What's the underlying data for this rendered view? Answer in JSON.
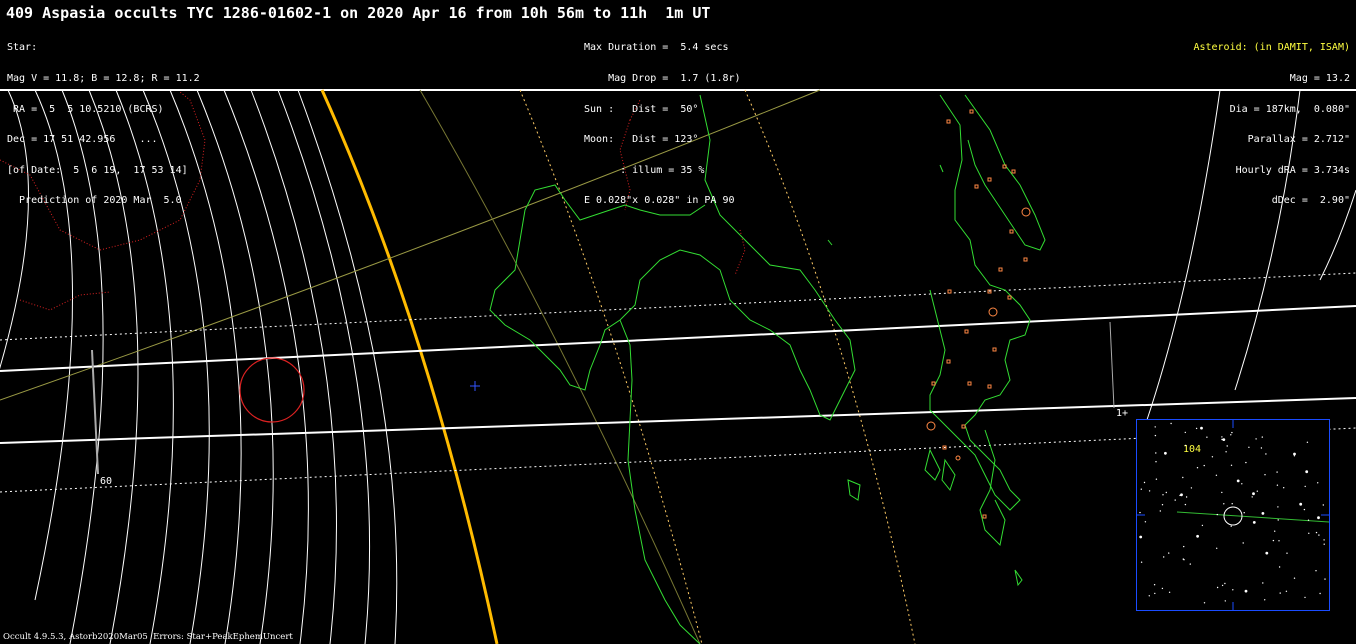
{
  "header": {
    "title": "409 Aspasia occults TYC 1286-01602-1 on 2020 Apr 16 from 10h 56m to 11h  1m UT",
    "star": {
      "heading": "Star:",
      "mag": "Mag V = 11.8; B = 12.8; R = 11.2",
      "ra": " RA =  5  5 10.5210 (BCRS)",
      "dec": "Dec = 17 51 42.956    ...",
      "of_date": "[of Date:  5  6 19,  17 53 14]",
      "prediction": "  Prediction of 2020 Mar  5.0"
    },
    "event": {
      "max_duration": "Max Duration =  5.4 secs",
      "mag_drop": "    Mag Drop =  1.7 (1.8r)",
      "sun": "Sun :   Dist =  50°",
      "moon": "Moon:   Dist = 123°",
      "illum": "      : illum = 35 %",
      "error_ellipse": "E 0.028\"x 0.028\" in PA 90"
    },
    "asteroid": {
      "heading": "Asteroid: (in DAMIT, ISAM)",
      "mag": "Mag = 13.2",
      "dia": "Dia = 187km,  0.080\"",
      "parallax": "Parallax = 2.712\"",
      "hourly_dra": "Hourly dRA = 3.734s",
      "ddec": "dDec =  2.90\""
    }
  },
  "map_labels": {
    "scale_label": "60",
    "time_tick": "1+"
  },
  "inset": {
    "label": "104"
  },
  "footer": "Occult 4.9.5.3, Astorb2020Mar05  Errors: Star+PeakEphemUncert",
  "colors": {
    "path_line": "#ffffff",
    "coastline": "#33dd33",
    "border": "#dd2222",
    "sun_line": "#ffcc00",
    "sites": "#ff8844",
    "inset_border": "#1a4cff",
    "target_circle": "#dd2222"
  }
}
